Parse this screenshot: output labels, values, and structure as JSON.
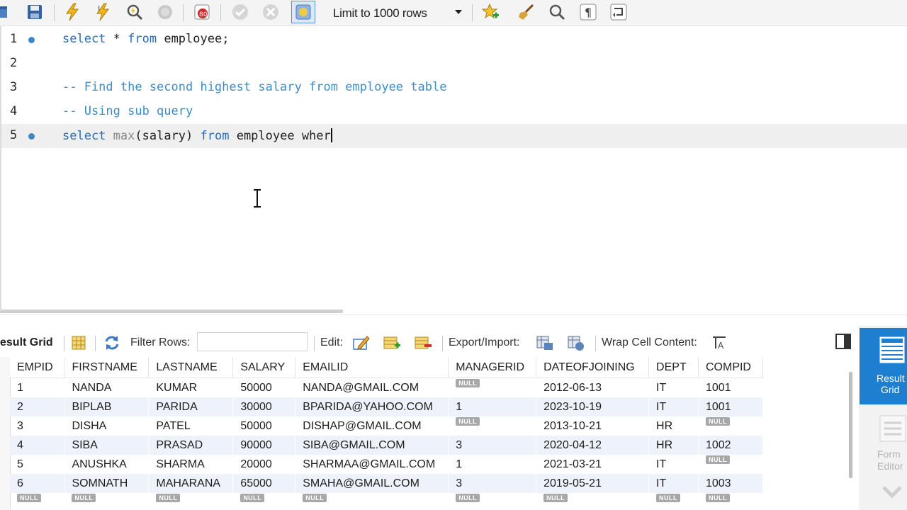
{
  "toolbar": {
    "limit_label": "Limit to 1000 rows"
  },
  "editor": {
    "lines": [
      {
        "num": "1",
        "segments": [
          {
            "t": "select",
            "c": "kw"
          },
          {
            "t": " * ",
            "c": ""
          },
          {
            "t": "from",
            "c": "kw"
          },
          {
            "t": " employee;",
            "c": ""
          }
        ]
      },
      {
        "num": "2",
        "segments": []
      },
      {
        "num": "3",
        "segments": [
          {
            "t": "-- Find the second highest salary from employee table",
            "c": "cm"
          }
        ]
      },
      {
        "num": "4",
        "segments": [
          {
            "t": "-- Using sub query",
            "c": "cm"
          }
        ]
      },
      {
        "num": "5",
        "segments": [
          {
            "t": "select",
            "c": "kw"
          },
          {
            "t": " ",
            "c": ""
          },
          {
            "t": "max",
            "c": "fn"
          },
          {
            "t": "(salary) ",
            "c": ""
          },
          {
            "t": "from",
            "c": "kw"
          },
          {
            "t": " employee wher",
            "c": ""
          }
        ]
      }
    ]
  },
  "results_toolbar": {
    "result_grid_label": "esult Grid",
    "filter_rows_label": "Filter Rows:",
    "edit_label": "Edit:",
    "export_import_label": "Export/Import:",
    "wrap_label": "Wrap Cell Content:"
  },
  "grid": {
    "columns": [
      "EMPID",
      "FIRSTNAME",
      "LASTNAME",
      "SALARY",
      "EMAILID",
      "MANAGERID",
      "DATEOFJOINING",
      "DEPT",
      "COMPID"
    ],
    "rows": [
      [
        "1",
        "NANDA",
        "KUMAR",
        "50000",
        "NANDA@GMAIL.COM",
        "NULL",
        "2012-06-13",
        "IT",
        "1001"
      ],
      [
        "2",
        "BIPLAB",
        "PARIDA",
        "30000",
        "BPARIDA@YAHOO.COM",
        "1",
        "2023-10-19",
        "IT",
        "1001"
      ],
      [
        "3",
        "DISHA",
        "PATEL",
        "50000",
        "DISHAP@GMAIL.COM",
        "NULL",
        "2013-10-21",
        "HR",
        "NULL"
      ],
      [
        "4",
        "SIBA",
        "PRASAD",
        "90000",
        "SIBA@GMAIL.COM",
        "3",
        "2020-04-12",
        "HR",
        "1002"
      ],
      [
        "5",
        "ANUSHKA",
        "SHARMA",
        "20000",
        "SHARMAA@GMAIL.COM",
        "1",
        "2021-03-21",
        "IT",
        "NULL"
      ],
      [
        "6",
        "SOMNATH",
        "MAHARANA",
        "65000",
        "SMAHA@GMAIL.COM",
        "3",
        "2019-05-21",
        "IT",
        "1003"
      ],
      [
        "NULL",
        "NULL",
        "NULL",
        "NULL",
        "NULL",
        "NULL",
        "NULL",
        "NULL",
        "NULL"
      ]
    ],
    "null_text": "NULL"
  },
  "side_panel": {
    "result_grid_line1": "Result",
    "result_grid_line2": "Grid",
    "form_editor_line1": "Form",
    "form_editor_line2": "Editor"
  }
}
